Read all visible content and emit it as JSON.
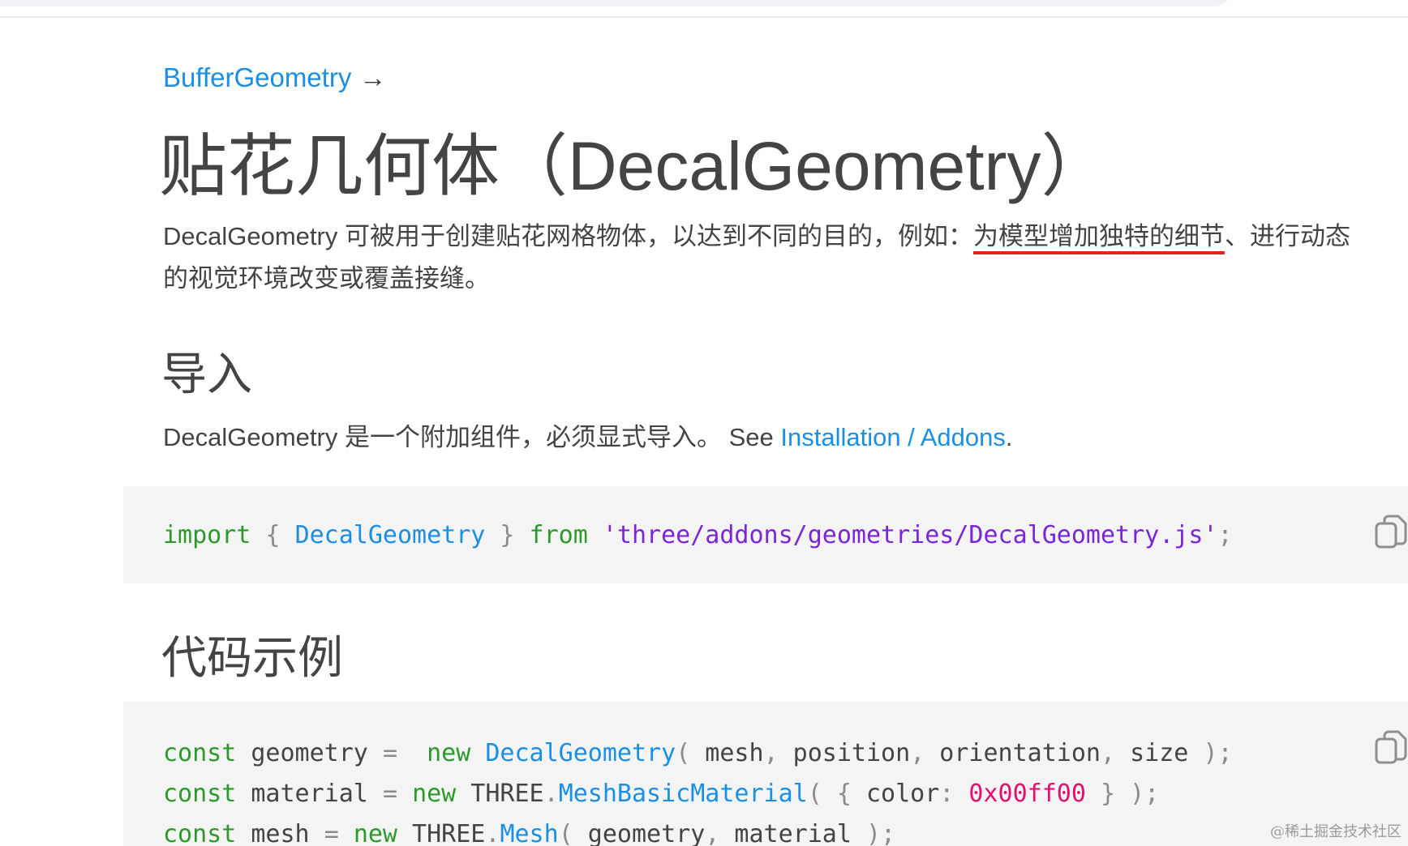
{
  "breadcrumb": {
    "link_label": "BufferGeometry",
    "arrow": "→"
  },
  "page": {
    "title": "贴花几何体（DecalGeometry）",
    "description_before": "DecalGeometry 可被用于创建贴花网格物体，以达到不同的目的，例如：",
    "description_marked": "为模型增加独特的细节",
    "description_after": "、进行动态的视觉环境改变或覆盖接缝。"
  },
  "import_section": {
    "heading": "导入",
    "text_before": "DecalGeometry 是一个附加组件，必须显式导入。 See ",
    "link_label": "Installation / Addons",
    "text_after": ".",
    "code": {
      "kw_import": "import",
      "brace_open": " { ",
      "class_name": "DecalGeometry",
      "brace_close": " } ",
      "kw_from": "from",
      "space": " ",
      "path": "'three/addons/geometries/DecalGeometry.js'",
      "semicolon": ";"
    }
  },
  "example_section": {
    "heading": "代码示例",
    "line1": {
      "kw_const": "const",
      "ident": " geometry ",
      "eq": "=",
      "pad": "  ",
      "kw_new": "new",
      "sp": " ",
      "cls": "DecalGeometry",
      "paren_open": "(",
      "a1": " mesh",
      "c1": ",",
      "a2": " position",
      "c2": ",",
      "a3": " orientation",
      "c3": ",",
      "a4": " size ",
      "end": ");"
    },
    "line2": {
      "kw_const": "const",
      "ident": " material ",
      "eq": "=",
      "sp1": " ",
      "kw_new": "new",
      "ns": " THREE",
      "dot": ".",
      "cls": "MeshBasicMaterial",
      "paren_open": "( {",
      "prop": " color",
      "colon": ":",
      "sp2": " ",
      "num": "0x00ff00",
      "end": " } );"
    },
    "line3": {
      "kw_const": "const",
      "ident": " mesh ",
      "eq": "=",
      "sp1": " ",
      "kw_new": "new",
      "ns": " THREE",
      "dot": ".",
      "cls": "Mesh",
      "paren_open": "(",
      "a1": " geometry",
      "c1": ",",
      "a2": " material ",
      "end": ");"
    }
  },
  "icons": {
    "copy": "copy-icon",
    "arrow": "arrow-right-icon"
  },
  "colors": {
    "link": "#1a8fe3",
    "keyword": "#2b9a2b",
    "string": "#7c25d6",
    "number": "#e0106e",
    "underline_mark": "#e8231f",
    "code_bg": "#f4f4f4"
  },
  "watermark": "@稀土掘金技术社区"
}
